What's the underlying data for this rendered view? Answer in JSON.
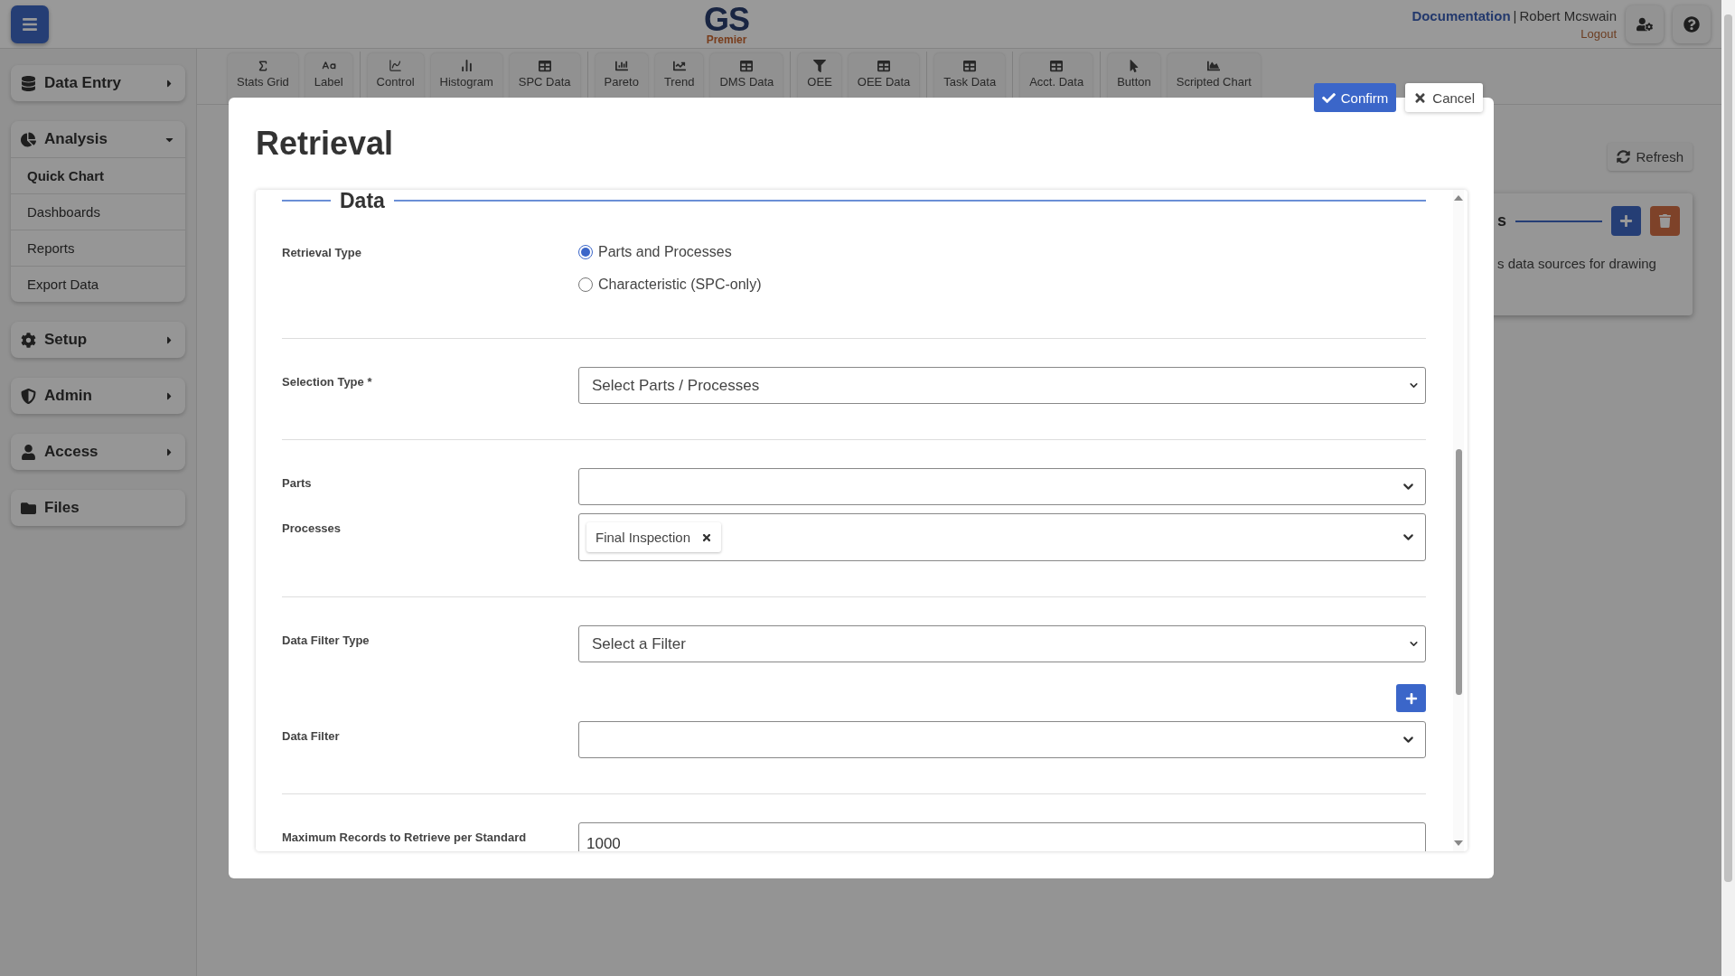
{
  "header": {
    "logo": {
      "title": "GS",
      "subtitle": "Premier"
    },
    "documentation_link": "Documentation",
    "separator": "|",
    "user": "Robert Mcswain",
    "logout_link": "Logout"
  },
  "sidebar": {
    "groups": [
      {
        "label": "Data Entry",
        "expanded": false
      },
      {
        "label": "Analysis",
        "expanded": true,
        "children": [
          {
            "label": "Quick Chart",
            "selected": true
          },
          {
            "label": "Dashboards",
            "selected": false
          },
          {
            "label": "Reports",
            "selected": false
          },
          {
            "label": "Export Data",
            "selected": false
          }
        ]
      },
      {
        "label": "Setup",
        "expanded": false
      },
      {
        "label": "Admin",
        "expanded": false
      },
      {
        "label": "Access",
        "expanded": false
      },
      {
        "label": "Files"
      }
    ]
  },
  "toolbar": {
    "groups": [
      [
        "Stats Grid",
        "Label"
      ],
      [
        "Control",
        "Histogram",
        "SPC Data"
      ],
      [
        "Pareto",
        "Trend",
        "DMS Data"
      ],
      [
        "OEE",
        "OEE Data"
      ],
      [
        "Task Data"
      ],
      [
        "Acct. Data"
      ],
      [
        "Button",
        "Scripted Chart"
      ]
    ]
  },
  "background": {
    "refresh_button": "Refresh",
    "card": {
      "heading": "s",
      "text": "s data sources for drawing"
    }
  },
  "modal": {
    "title": "Retrieval",
    "confirm_button": "Confirm",
    "cancel_button": "Cancel",
    "section": "Data",
    "rows": [
      {
        "kind": "radio",
        "label": "Retrieval Type",
        "options": [
          {
            "label": "Parts and Processes",
            "selected": true
          },
          {
            "label": "Characteristic (SPC-only)",
            "selected": false
          }
        ]
      },
      {
        "kind": "divider"
      },
      {
        "kind": "select",
        "label": "Selection Type *",
        "value": "Select Parts / Processes"
      },
      {
        "kind": "divider"
      },
      {
        "kind": "multiselect",
        "label": "Parts"
      },
      {
        "kind": "multiselect",
        "label": "Processes",
        "tags": [
          "Final Inspection"
        ]
      },
      {
        "kind": "divider"
      },
      {
        "kind": "select",
        "label": "Data Filter Type",
        "value": "Select a Filter"
      },
      {
        "kind": "add"
      },
      {
        "kind": "multiselect",
        "label": "Data Filter"
      },
      {
        "kind": "divider"
      },
      {
        "kind": "number",
        "label": "Maximum Records to Retrieve per Standard",
        "value": "1000"
      }
    ]
  }
}
